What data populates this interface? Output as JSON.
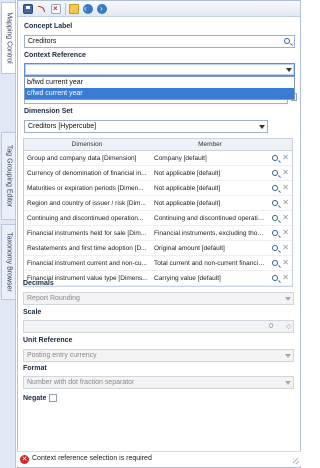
{
  "tabs": [
    {
      "label": "Mapping Control",
      "active": true
    },
    {
      "label": "Tag Grouping Editor",
      "active": false
    },
    {
      "label": "Taxonomy Browser",
      "active": false
    }
  ],
  "toolbar": {
    "icons": [
      "save-icon",
      "undo-icon",
      "clear-icon",
      "open-folder-icon",
      "back-icon",
      "forward-icon"
    ]
  },
  "concept": {
    "label": "Concept Label",
    "value": "Creditors"
  },
  "context": {
    "label": "Context Reference",
    "value": "",
    "options": [
      "b/fwd current year",
      "c/fwd current year"
    ],
    "selected_index": 1
  },
  "dimension_set": {
    "label": "Dimension Set",
    "value": "Creditors [Hypercube]"
  },
  "dimensions_table": {
    "headers": [
      "Dimension",
      "Member"
    ],
    "rows": [
      [
        "Group and company data [Dimension]",
        "Company [default]"
      ],
      [
        "Currency of denomination of financial in...",
        "Not applicable [default]"
      ],
      [
        "Maturities or expiration periods [Dimen...",
        "Not applicable [default]"
      ],
      [
        "Region and country of issuer / risk [Dim...",
        "Not applicable [default]"
      ],
      [
        "Continuing and discontinued operation...",
        "Continuing and discontinued operatio..."
      ],
      [
        "Financial instruments held for sale [Dim...",
        "Financial instruments, excluding those..."
      ],
      [
        "Restatements and first time adoption [D...",
        "Original amount [default]"
      ],
      [
        "Financial instrument current and non-cu...",
        "Total current and non-current financial i..."
      ],
      [
        "Financial instrument value type [Dimens...",
        "Carrying value [default]"
      ]
    ]
  },
  "decimals": {
    "label": "Decimals",
    "value": "Report Rounding"
  },
  "scale": {
    "label": "Scale",
    "value": "0"
  },
  "unit_reference": {
    "label": "Unit Reference",
    "value": "Posting entry currency"
  },
  "format": {
    "label": "Format",
    "value": "Number with dot fraction separator"
  },
  "negate": {
    "label": "Negate",
    "checked": false
  },
  "status": {
    "message": "Context reference selection is required",
    "level": "error"
  },
  "colors": {
    "selection": "#3a7bd5",
    "error": "#dd2222",
    "tab_background": "#dfe8f4"
  }
}
